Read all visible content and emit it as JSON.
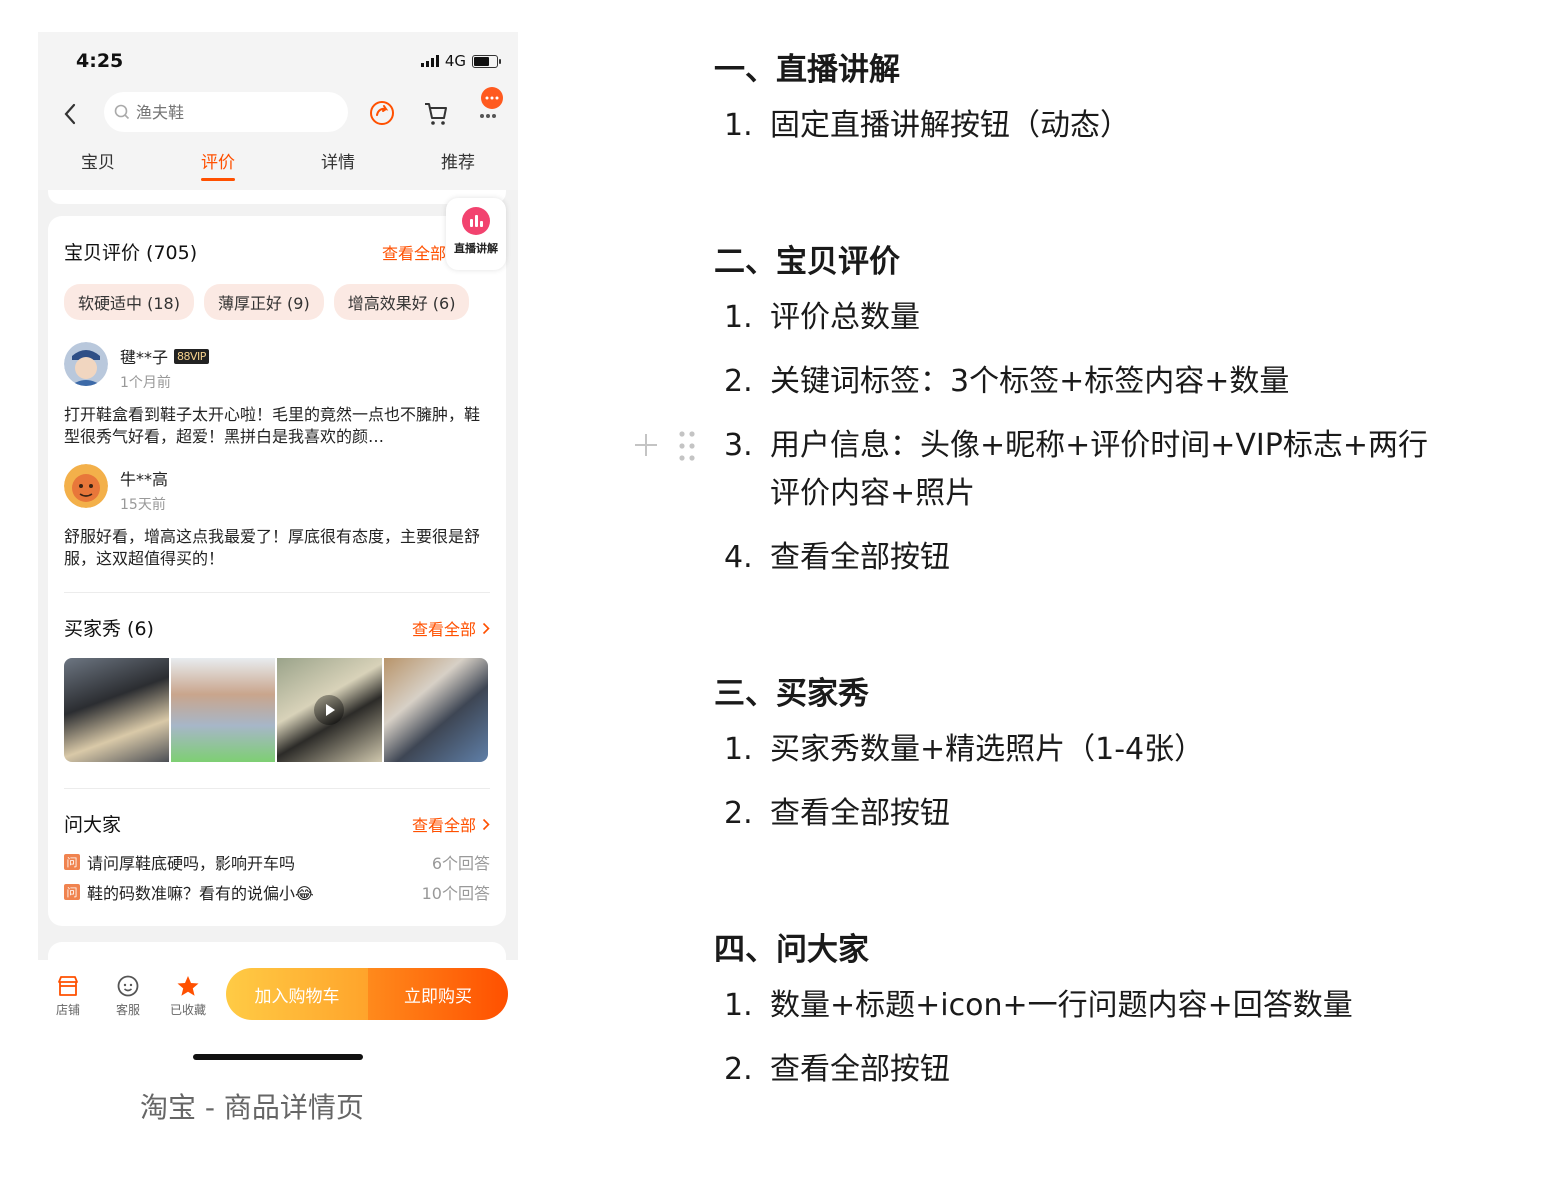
{
  "phone": {
    "status": {
      "time": "4:25",
      "network": "4G",
      "battery_level": 0.7
    },
    "search": {
      "placeholder": "渔夫鞋"
    },
    "tabs": [
      {
        "label": "宝贝",
        "active": false
      },
      {
        "label": "评价",
        "active": true
      },
      {
        "label": "详情",
        "active": false
      },
      {
        "label": "推荐",
        "active": false
      }
    ],
    "reviews": {
      "title": "宝贝评价 (705)",
      "see_all": "查看全部",
      "tags": [
        "软硬适中 (18)",
        "薄厚正好 (9)",
        "增高效果好 (6)"
      ],
      "items": [
        {
          "name": "毽**子",
          "vip": "88VIP",
          "time": "1个月前",
          "text": "打开鞋盒看到鞋子太开心啦！毛里的竟然一点也不臃肿，鞋型很秀气好看，超爱！黑拼白是我喜欢的颜…"
        },
        {
          "name": "牛**高",
          "vip": "",
          "time": "15天前",
          "text": "舒服好看，增高这点我最爱了！厚底很有态度，主要很是舒服，这双超值得买的！"
        }
      ]
    },
    "live_float": {
      "label": "直播讲解"
    },
    "buyer_show": {
      "title": "买家秀 (6)",
      "see_all": "查看全部"
    },
    "ask": {
      "title": "问大家",
      "see_all": "查看全部",
      "icon_label": "问",
      "items": [
        {
          "question": "请问厚鞋底硬吗，影响开车吗",
          "answers": "6个回答"
        },
        {
          "question": "鞋的码数准嘛？看有的说偏小😂",
          "answers": "10个回答"
        }
      ]
    },
    "bottom": {
      "shop": "店铺",
      "service": "客服",
      "favorited": "已收藏",
      "add_cart": "加入购物车",
      "buy_now": "立即购买"
    },
    "caption": "淘宝 - 商品详情页"
  },
  "doc": {
    "sections": [
      {
        "heading": "一、直播讲解",
        "items": [
          [
            "1.",
            "固定直播讲解按钮（动态）"
          ]
        ]
      },
      {
        "heading": "二、宝贝评价",
        "items": [
          [
            "1.",
            "评价总数量"
          ],
          [
            "2.",
            "关键词标签：3个标签+标签内容+数量"
          ],
          [
            "3.",
            "用户信息：头像+昵称+评价时间+VIP标志+两行"
          ],
          [
            "",
            "评价内容+照片"
          ],
          [
            "4.",
            "查看全部按钮"
          ]
        ]
      },
      {
        "heading": "三、买家秀",
        "items": [
          [
            "1.",
            "买家秀数量+精选照片（1-4张）"
          ],
          [
            "2.",
            "查看全部按钮"
          ]
        ]
      },
      {
        "heading": "四、问大家",
        "items": [
          [
            "1.",
            "数量+标题+icon+一行问题内容+回答数量"
          ],
          [
            "2.",
            "查看全部按钮"
          ]
        ]
      }
    ]
  }
}
